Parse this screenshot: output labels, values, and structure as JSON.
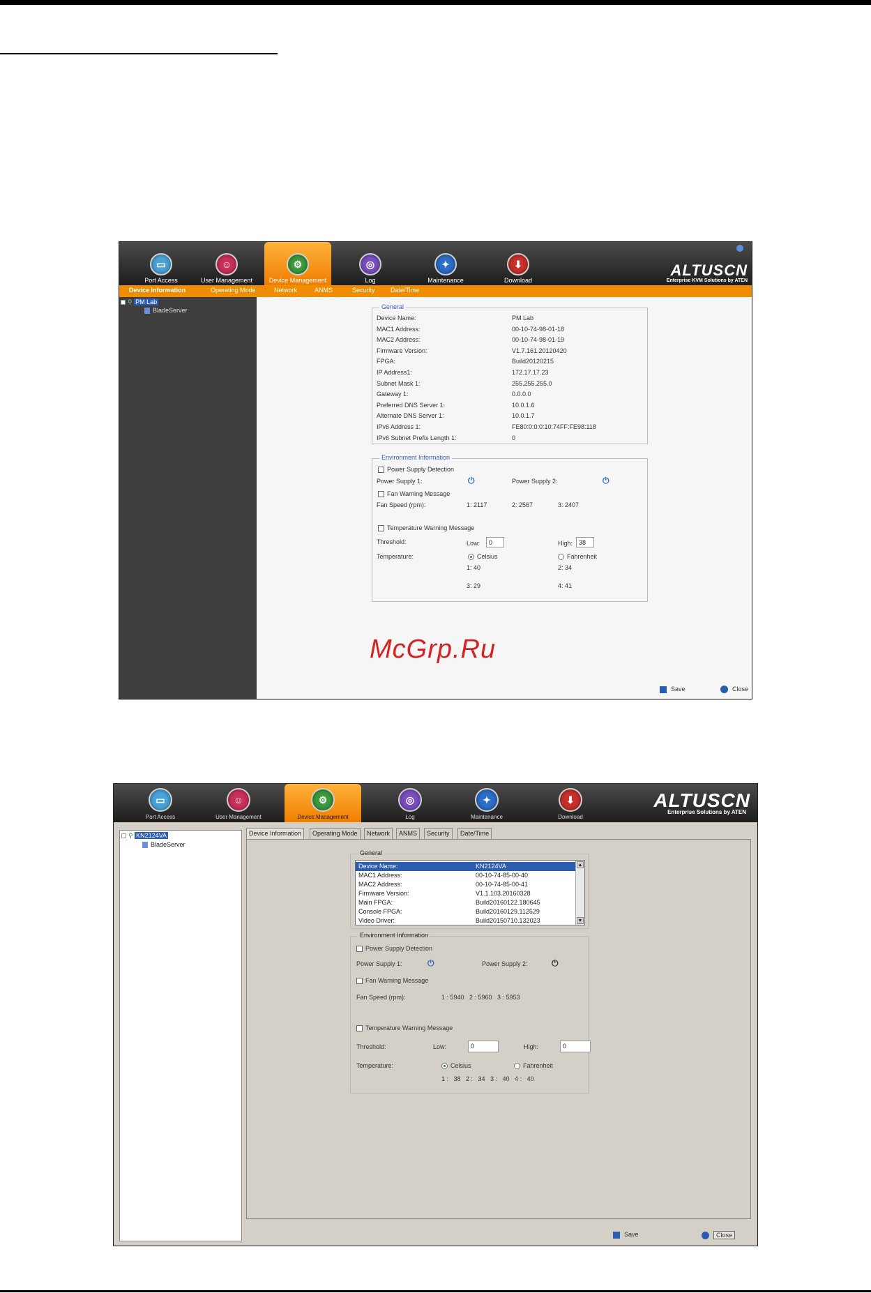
{
  "screenshot1": {
    "nav": [
      {
        "label": "Port Access",
        "icon": "monitor-icon"
      },
      {
        "label": "User Management",
        "icon": "users-icon"
      },
      {
        "label": "Device Management",
        "icon": "gear-icon",
        "active": true
      },
      {
        "label": "Log",
        "icon": "log-icon"
      },
      {
        "label": "Maintenance",
        "icon": "wrench-icon"
      },
      {
        "label": "Download",
        "icon": "download-icon"
      }
    ],
    "logo": "ALTUSCN",
    "logo_sub": "Enterprise KVM Solutions by ATEN",
    "subtabs": [
      "Device Information",
      "Operating Mode",
      "Network",
      "ANMS",
      "Security",
      "Date/Time"
    ],
    "tree": {
      "root": "PM Lab",
      "child": "BladeServer"
    },
    "general": {
      "title": "General",
      "rows": [
        {
          "k": "Device Name:",
          "v": "PM Lab"
        },
        {
          "k": "MAC1 Address:",
          "v": "00-10-74-98-01-18"
        },
        {
          "k": "MAC2 Address:",
          "v": "00-10-74-98-01-19"
        },
        {
          "k": "Firmware Version:",
          "v": "V1.7.161.20120420"
        },
        {
          "k": "FPGA:",
          "v": "Build20120215"
        },
        {
          "k": "IP Address1:",
          "v": "172.17.17.23"
        },
        {
          "k": "Subnet Mask 1:",
          "v": "255.255.255.0"
        },
        {
          "k": "Gateway 1:",
          "v": "0.0.0.0"
        },
        {
          "k": "Preferred DNS Server 1:",
          "v": "10.0.1.6"
        },
        {
          "k": "Alternate DNS Server 1:",
          "v": "10.0.1.7"
        },
        {
          "k": "IPv6 Address 1:",
          "v": "FE80:0:0:0:10:74FF:FE98:118"
        },
        {
          "k": "IPv6 Subnet Prefix Length 1:",
          "v": "0"
        }
      ]
    },
    "env": {
      "title": "Environment Information",
      "power_detect": "Power Supply Detection",
      "ps1": "Power Supply 1:",
      "ps2": "Power Supply 2:",
      "fan_warning": "Fan Warning Message",
      "fan_speed": "Fan Speed (rpm):",
      "fan1": "1: 2117",
      "fan2": "2: 2567",
      "fan3": "3: 2407",
      "temp_warning": "Temperature Warning Message",
      "threshold": "Threshold:",
      "low_label": "Low:",
      "low_value": "0",
      "high_label": "High:",
      "high_value": "38",
      "temperature": "Temperature:",
      "celsius": "Celsius",
      "fahrenheit": "Fahrenheit",
      "t1": "1: 40",
      "t2": "2: 34",
      "t3": "3: 29",
      "t4": "4: 41"
    },
    "save": "Save",
    "close": "Close"
  },
  "watermark": "McGrp.Ru",
  "screenshot2": {
    "nav": [
      {
        "label": "Port Access",
        "icon": "monitor-icon"
      },
      {
        "label": "User Management",
        "icon": "users-icon"
      },
      {
        "label": "Device Management",
        "icon": "gear-icon",
        "active": true
      },
      {
        "label": "Log",
        "icon": "log-icon"
      },
      {
        "label": "Maintenance",
        "icon": "wrench-icon"
      },
      {
        "label": "Download",
        "icon": "download-icon"
      }
    ],
    "logo": "ALTUSCN",
    "logo_sub": "Enterprise Solutions by ATEN",
    "tree": {
      "root": "KN2124VA",
      "child": "BladeServer"
    },
    "tabs": [
      "Device Information",
      "Operating Mode",
      "Network",
      "ANMS",
      "Security",
      "Date/Time"
    ],
    "general": {
      "title": "General",
      "rows": [
        {
          "k": "Device Name:",
          "v": "KN2124VA"
        },
        {
          "k": "MAC1 Address:",
          "v": "00-10-74-85-00-40"
        },
        {
          "k": "MAC2 Address:",
          "v": "00-10-74-85-00-41"
        },
        {
          "k": "Firmware Version:",
          "v": "V1.1.103.20160328"
        },
        {
          "k": "Main FPGA:",
          "v": "Build20160122.180645"
        },
        {
          "k": "Console FPGA:",
          "v": "Build20160129.112529"
        },
        {
          "k": "Video Driver:",
          "v": "Build20150710.132023"
        }
      ]
    },
    "env": {
      "title": "Environment Information",
      "power_detect": "Power Supply Detection",
      "ps1": "Power Supply 1:",
      "ps2": "Power Supply 2:",
      "fan_warning": "Fan Warning Message",
      "fan_speed": "Fan Speed (rpm):",
      "fan_values": "1 : 5940   2 : 5960   3 : 5953",
      "temp_warning": "Temperature Warning Message",
      "threshold": "Threshold:",
      "low_label": "Low:",
      "low_value": "0",
      "high_label": "High:",
      "high_value": "0",
      "temperature": "Temperature:",
      "celsius": "Celsius",
      "fahrenheit": "Fahrenheit",
      "temp_values": "1 :   38   2 :   34   3 :   40   4 :   40"
    },
    "save": "Save",
    "close": "Close"
  }
}
